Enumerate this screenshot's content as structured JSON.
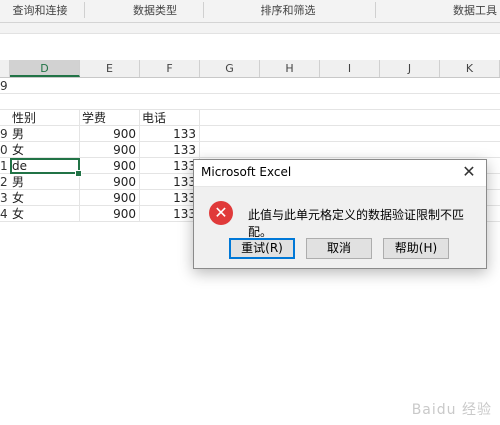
{
  "ribbon": {
    "groups": [
      "查询和连接",
      "数据类型",
      "排序和筛选",
      "数据工具"
    ]
  },
  "name_row_fragment": "9",
  "columns": [
    "D",
    "E",
    "F",
    "G",
    "H",
    "I",
    "J",
    "K"
  ],
  "active_column": "D",
  "rows": [
    {
      "num": "",
      "d": "性别",
      "e": "学费",
      "f": "电话"
    },
    {
      "num": "9",
      "d": "男",
      "e": "900",
      "f": "133"
    },
    {
      "num": "0",
      "d": "女",
      "e": "900",
      "f": "133"
    },
    {
      "num": "1",
      "d": "de",
      "e": "900",
      "f": "133"
    },
    {
      "num": "2",
      "d": "男",
      "e": "900",
      "f": "133"
    },
    {
      "num": "3",
      "d": "女",
      "e": "900",
      "f": "133"
    },
    {
      "num": "4",
      "d": "女",
      "e": "900",
      "f": "133"
    }
  ],
  "dialog": {
    "title": "Microsoft Excel",
    "close_glyph": "✕",
    "icon_glyph": "✕",
    "message": "此值与此单元格定义的数据验证限制不匹配。",
    "buttons": {
      "retry": "重试(R)",
      "cancel": "取消",
      "help": "帮助(H)"
    }
  },
  "watermark": "Baidu 经验",
  "colors": {
    "accent": "#217346",
    "error": "#e03a3a"
  }
}
